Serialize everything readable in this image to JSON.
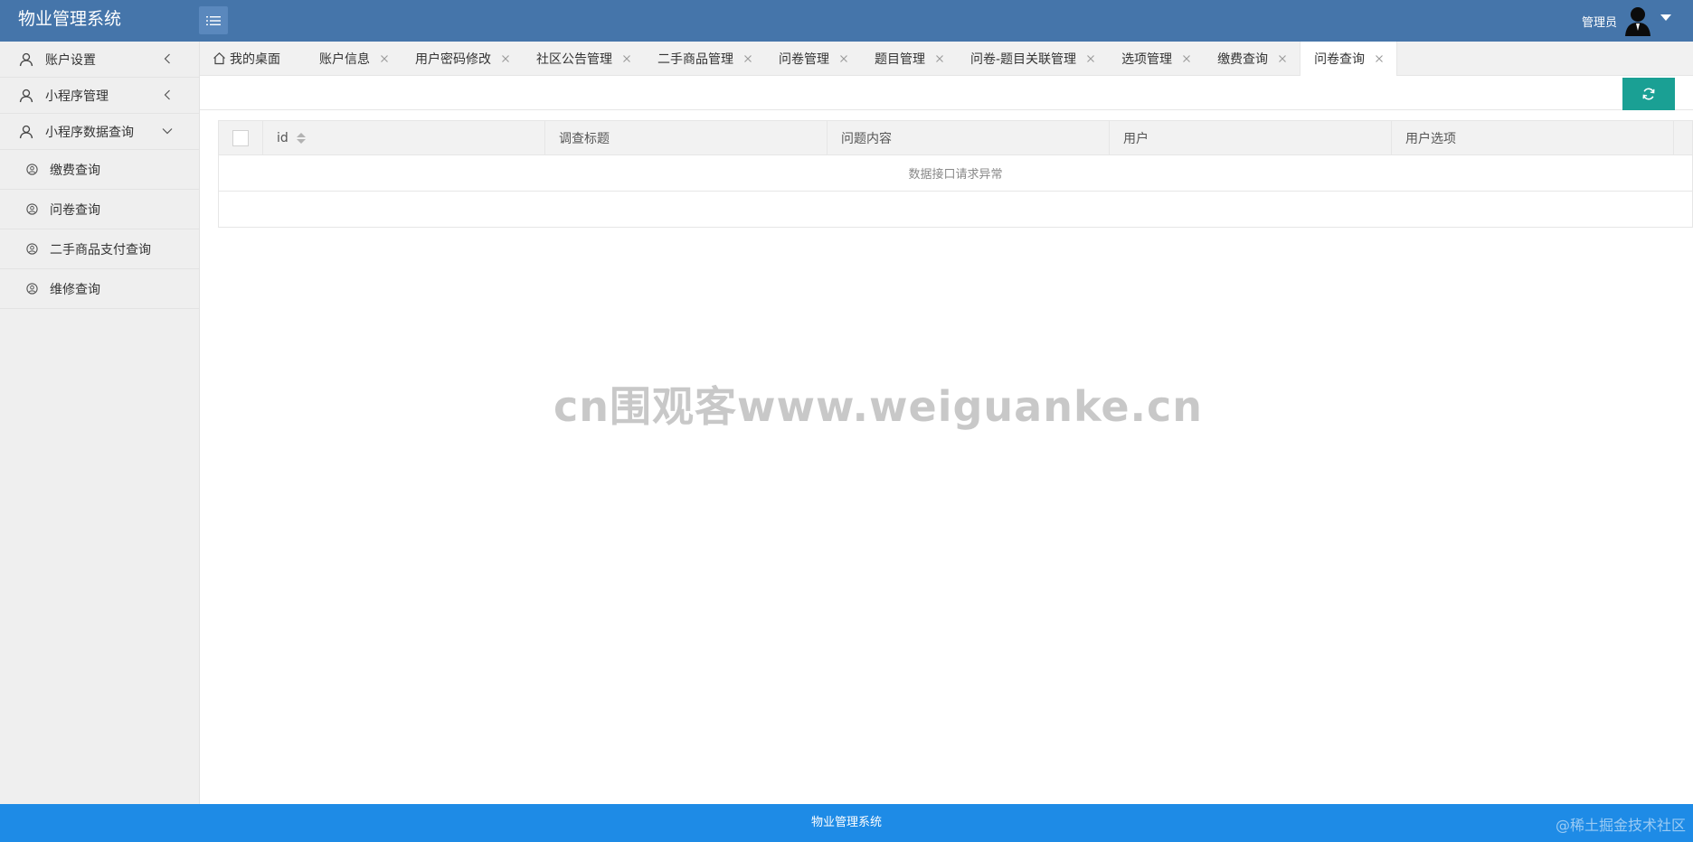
{
  "header": {
    "title": "物业管理系统",
    "user_name": "管理员"
  },
  "sidebar": {
    "groups": [
      {
        "label": "账户设置",
        "expanded": false
      },
      {
        "label": "小程序管理",
        "expanded": false
      },
      {
        "label": "小程序数据查询",
        "expanded": true
      }
    ],
    "sub_items": [
      {
        "label": "缴费查询"
      },
      {
        "label": "问卷查询"
      },
      {
        "label": "二手商品支付查询"
      },
      {
        "label": "维修查询"
      }
    ]
  },
  "tabs": [
    {
      "label": "我的桌面"
    },
    {
      "label": "账户信息"
    },
    {
      "label": "用户密码修改"
    },
    {
      "label": "社区公告管理"
    },
    {
      "label": "二手商品管理"
    },
    {
      "label": "问卷管理"
    },
    {
      "label": "题目管理"
    },
    {
      "label": "问卷-题目关联管理"
    },
    {
      "label": "选项管理"
    },
    {
      "label": "缴费查询"
    },
    {
      "label": "问卷查询"
    }
  ],
  "table": {
    "columns": [
      "id",
      "调查标题",
      "问题内容",
      "用户",
      "用户选项"
    ],
    "empty_message": "数据接口请求异常"
  },
  "watermark": "cn围观客www.weiguanke.cn",
  "footer": {
    "text": "物业管理系统",
    "credit": "@稀土掘金技术社区"
  },
  "colors": {
    "header_bg": "#4575aa",
    "footer_bg": "#1e8be6",
    "refresh_button": "#1aa094",
    "sidebar_bg": "#efefef"
  }
}
